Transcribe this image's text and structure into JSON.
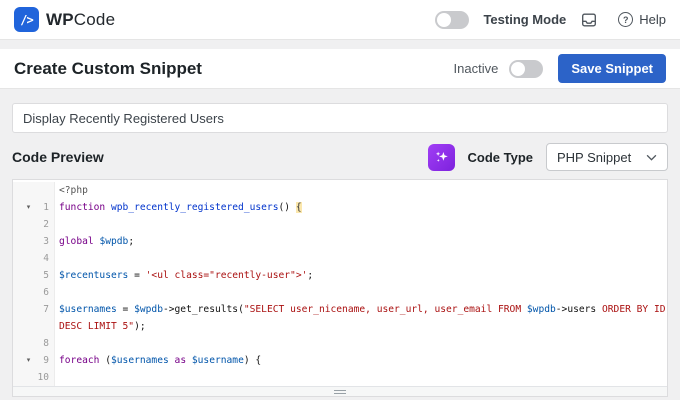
{
  "header": {
    "logo_glyph": "/>",
    "brand_bold": "WP",
    "brand_rest": "Code",
    "testing_mode_label": "Testing Mode",
    "help_label": "Help",
    "icons": {
      "inbox": "inbox-tray-icon",
      "help": "question-circle-icon"
    }
  },
  "toolbar": {
    "page_title": "Create Custom Snippet",
    "status_label": "Inactive",
    "save_label": "Save Snippet"
  },
  "snippet": {
    "title_value": "Display Recently Registered Users"
  },
  "code_preview": {
    "heading": "Code Preview",
    "code_type_label": "Code Type",
    "code_type_value": "PHP Snippet",
    "ai_icon": "sparkles-icon"
  },
  "colors": {
    "brand_blue": "#2064db",
    "button_blue": "#2c63c8",
    "ai_purple_start": "#a13ef5",
    "ai_purple_end": "#7d22dd",
    "keyword": "#770088",
    "variable": "#0055aa",
    "string": "#aa1111"
  },
  "editor": {
    "lines": [
      {
        "num": "",
        "fold": false,
        "segs": [
          {
            "t": "<?php",
            "c": "meta"
          }
        ]
      },
      {
        "num": "1",
        "fold": true,
        "segs": [
          {
            "t": "function ",
            "c": "kw"
          },
          {
            "t": "wpb_recently_registered_users",
            "c": "def"
          },
          {
            "t": "() ",
            "c": "plain"
          },
          {
            "t": "{",
            "c": "brhl"
          }
        ]
      },
      {
        "num": "2",
        "fold": false,
        "segs": []
      },
      {
        "num": "3",
        "fold": false,
        "segs": [
          {
            "t": "global ",
            "c": "kw"
          },
          {
            "t": "$wpdb",
            "c": "var"
          },
          {
            "t": ";",
            "c": "plain"
          }
        ]
      },
      {
        "num": "4",
        "fold": false,
        "segs": []
      },
      {
        "num": "5",
        "fold": false,
        "segs": [
          {
            "t": "$recentusers",
            "c": "var"
          },
          {
            "t": " = ",
            "c": "plain"
          },
          {
            "t": "'<ul class=\"recently-user\">'",
            "c": "str"
          },
          {
            "t": ";",
            "c": "plain"
          }
        ]
      },
      {
        "num": "6",
        "fold": false,
        "segs": []
      },
      {
        "num": "7",
        "fold": false,
        "segs": [
          {
            "t": "$usernames",
            "c": "var"
          },
          {
            "t": " = ",
            "c": "plain"
          },
          {
            "t": "$wpdb",
            "c": "var"
          },
          {
            "t": "->get_results(",
            "c": "plain"
          },
          {
            "t": "\"SELECT user_nicename, user_url, user_email FROM ",
            "c": "str"
          },
          {
            "t": "$wpdb",
            "c": "var"
          },
          {
            "t": "->users ",
            "c": "plain"
          },
          {
            "t": "ORDER BY ID",
            "c": "str"
          }
        ]
      },
      {
        "num": "",
        "fold": false,
        "segs": [
          {
            "t": "DESC LIMIT 5\"",
            "c": "str"
          },
          {
            "t": ");",
            "c": "plain"
          }
        ]
      },
      {
        "num": "8",
        "fold": false,
        "segs": []
      },
      {
        "num": "9",
        "fold": true,
        "segs": [
          {
            "t": "foreach ",
            "c": "kw"
          },
          {
            "t": "(",
            "c": "plain"
          },
          {
            "t": "$usernames",
            "c": "var"
          },
          {
            "t": " as ",
            "c": "kw"
          },
          {
            "t": "$username",
            "c": "var"
          },
          {
            "t": ") {",
            "c": "plain"
          }
        ]
      },
      {
        "num": "10",
        "fold": false,
        "segs": []
      }
    ]
  }
}
